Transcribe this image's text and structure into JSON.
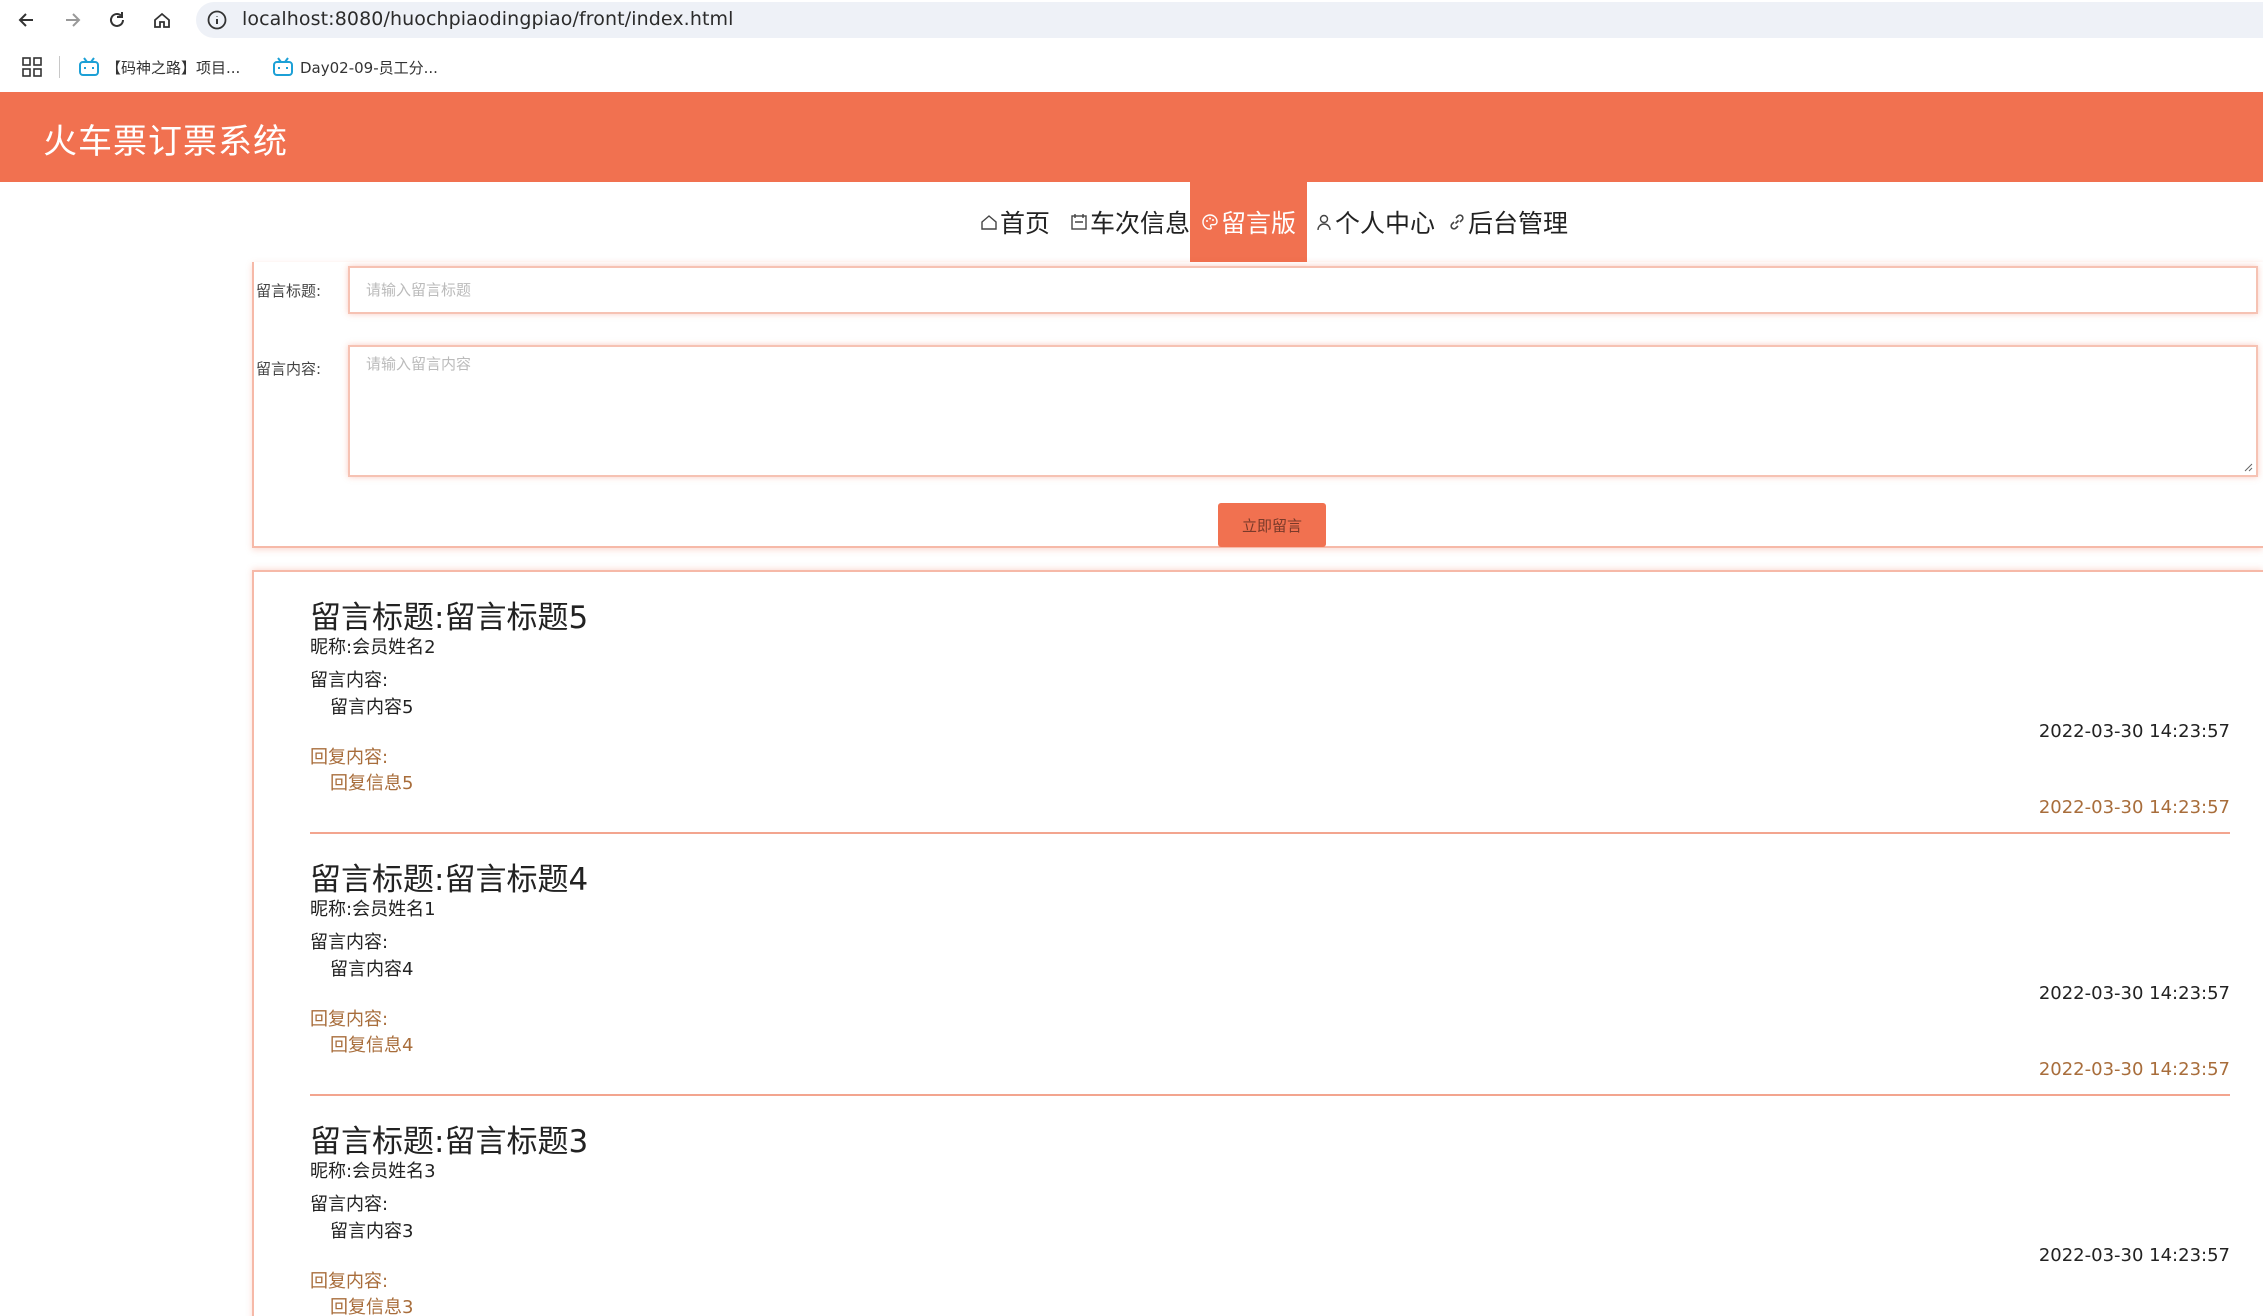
{
  "browser": {
    "url": "localhost:8080/huochpiaodingpiao/front/index.html",
    "bookmarks": [
      {
        "label": "【码神之路】项目...",
        "icon": "bilibili-icon"
      },
      {
        "label": "Day02-09-员工分...",
        "icon": "bilibili-icon"
      }
    ]
  },
  "site": {
    "title": "火车票订票系统",
    "accent_color": "#f17150"
  },
  "nav": {
    "items": [
      {
        "label": "首页",
        "icon": "home-icon"
      },
      {
        "label": "车次信息",
        "icon": "calendar-icon"
      },
      {
        "label": "留言版",
        "icon": "palette-icon",
        "active": true
      },
      {
        "label": "个人中心",
        "icon": "user-icon"
      },
      {
        "label": "后台管理",
        "icon": "link-icon"
      }
    ]
  },
  "form": {
    "title_label": "留言标题:",
    "title_placeholder": "请输入留言标题",
    "content_label": "留言内容:",
    "content_placeholder": "请输入留言内容",
    "submit_label": "立即留言"
  },
  "messages": [
    {
      "title": "留言标题:留言标题5",
      "nickname": "昵称:会员姓名2",
      "content_label": "留言内容:",
      "content": "留言内容5",
      "time": "2022-03-30 14:23:57",
      "reply_label": "回复内容:",
      "reply": "回复信息5",
      "reply_time": "2022-03-30 14:23:57"
    },
    {
      "title": "留言标题:留言标题4",
      "nickname": "昵称:会员姓名1",
      "content_label": "留言内容:",
      "content": "留言内容4",
      "time": "2022-03-30 14:23:57",
      "reply_label": "回复内容:",
      "reply": "回复信息4",
      "reply_time": "2022-03-30 14:23:57"
    },
    {
      "title": "留言标题:留言标题3",
      "nickname": "昵称:会员姓名3",
      "content_label": "留言内容:",
      "content": "留言内容3",
      "time": "2022-03-30 14:23:57",
      "reply_label": "回复内容:",
      "reply": "回复信息3",
      "reply_time": ""
    }
  ]
}
